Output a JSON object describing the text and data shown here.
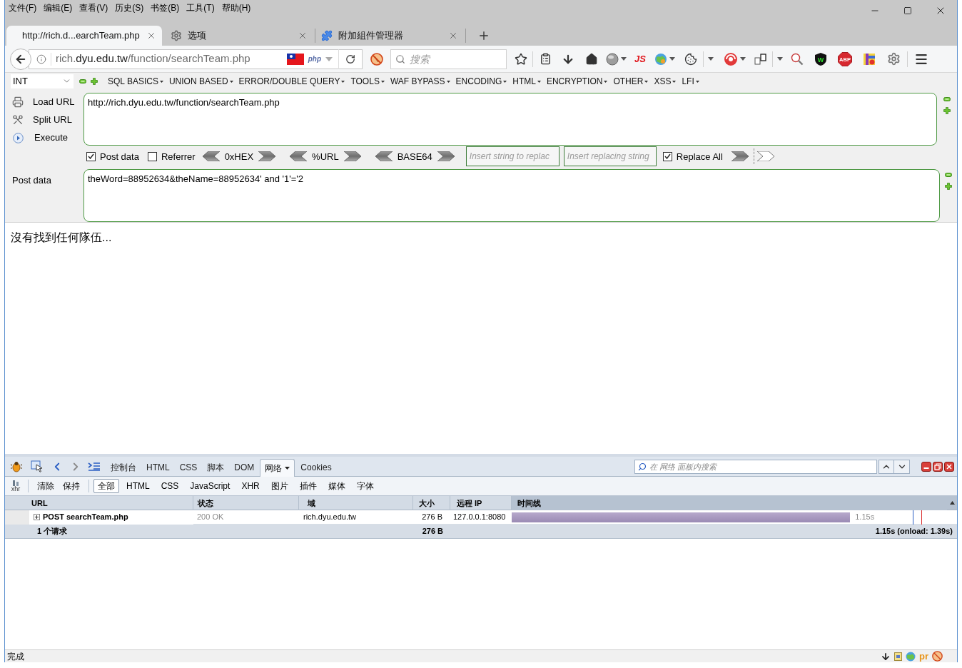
{
  "menu_bar": [
    "文件(F)",
    "编辑(E)",
    "查看(V)",
    "历史(S)",
    "书签(B)",
    "工具(T)",
    "帮助(H)"
  ],
  "tabs": [
    {
      "label": "http://rich.d...earchTeam.php",
      "kind": "page",
      "selected": true
    },
    {
      "label": "选项",
      "kind": "settings",
      "selected": false
    },
    {
      "label": "附加組件管理器",
      "kind": "addons",
      "selected": false
    }
  ],
  "address_bar": {
    "url_prefix": "rich.",
    "url_domain": "dyu.edu.tw",
    "url_path": "/function/searchTeam.php",
    "php_badge": "php"
  },
  "search": {
    "placeholder": "搜索"
  },
  "toolbar": {
    "js_button": "JS",
    "shield_letter": "W",
    "adblock_button": "ABP"
  },
  "hackbar": {
    "type_select": "INT",
    "menus": [
      "SQL BASICS",
      "UNION BASED",
      "ERROR/DOUBLE QUERY",
      "TOOLS",
      "WAF BYPASS",
      "ENCODING",
      "HTML",
      "ENCRYPTION",
      "OTHER",
      "XSS",
      "LFI"
    ],
    "actions": [
      {
        "label": "Load URL",
        "kind": "load"
      },
      {
        "label": "Split URL",
        "kind": "split"
      },
      {
        "label": "Execute",
        "kind": "execute"
      }
    ],
    "url_value": "http://rich.dyu.edu.tw/function/searchTeam.php",
    "options": [
      {
        "label": "Post data",
        "checked": true
      },
      {
        "label": "Referrer",
        "checked": false
      }
    ],
    "encoders": [
      "0xHEX",
      "%URL",
      "BASE64"
    ],
    "replace_from": {
      "placeholder": "Insert string to replac"
    },
    "replace_to": {
      "placeholder": "Insert replacing string"
    },
    "replace_all": {
      "label": "Replace All",
      "checked": true
    },
    "post_label": "Post data",
    "post_value": "theWord=88952634&theName=88952634' and '1'='2"
  },
  "page": {
    "message": "沒有找到任何隊伍..."
  },
  "firebug": {
    "panel_tabs": [
      {
        "label": "控制台",
        "selected": false
      },
      {
        "label": "HTML",
        "selected": false
      },
      {
        "label": "CSS",
        "selected": false
      },
      {
        "label": "脚本",
        "selected": false
      },
      {
        "label": "DOM",
        "selected": false
      },
      {
        "label": "网络",
        "selected": true
      },
      {
        "label": "Cookies",
        "selected": false
      }
    ],
    "search": {
      "placeholder": "在 网络 面板内搜索"
    },
    "xhr_label": "xhr",
    "actions": [
      "清除",
      "保持"
    ],
    "filters": [
      {
        "label": "全部",
        "selected": true
      },
      {
        "label": "HTML",
        "selected": false
      },
      {
        "label": "CSS",
        "selected": false
      },
      {
        "label": "JavaScript",
        "selected": false
      },
      {
        "label": "XHR",
        "selected": false
      },
      {
        "label": "图片",
        "selected": false
      },
      {
        "label": "插件",
        "selected": false
      },
      {
        "label": "媒体",
        "selected": false
      },
      {
        "label": "字体",
        "selected": false
      }
    ],
    "columns": [
      "URL",
      "状态",
      "域",
      "大小",
      "远程 IP",
      "时间线"
    ],
    "requests": [
      {
        "url": "POST searchTeam.php",
        "status": "200 OK",
        "domain": "rich.dyu.edu.tw",
        "size": "276 B",
        "remote_ip": "127.0.0.1:8080",
        "duration": "1.15s",
        "level": 0.76,
        "expanded": false
      }
    ],
    "summary": {
      "count": "1 个请求",
      "size": "276 B",
      "timing": "1.15s (onload: 1.39s)"
    }
  },
  "status_bar": {
    "text": "完成",
    "badge": "pr"
  }
}
